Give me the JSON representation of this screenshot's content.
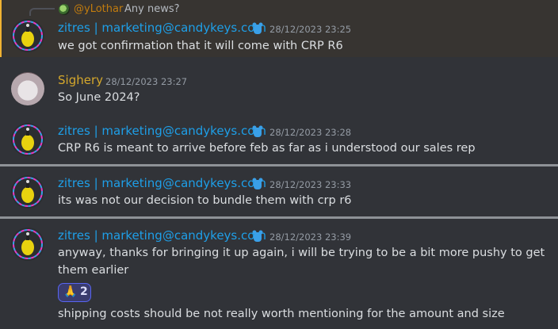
{
  "reply": {
    "name": "@yLothar",
    "text": "Any news?"
  },
  "messages": [
    {
      "author": "zitres | marketing@candykeys.com",
      "timestamp": "28/12/2023 23:25",
      "text": "we got confirmation that it will come with CRP R6",
      "badge_icon": "bear-icon",
      "highlighted": true
    },
    {
      "author": "Sighery",
      "timestamp": "28/12/2023 23:27",
      "text": "So June 2024?"
    },
    {
      "author": "zitres | marketing@candykeys.com",
      "timestamp": "28/12/2023 23:28",
      "text": "CRP R6 is meant to arrive before feb as far as i understood our sales rep",
      "badge_icon": "bear-icon"
    },
    {
      "author": "zitres | marketing@candykeys.com",
      "timestamp": "28/12/2023 23:33",
      "text": "its was not our decision to bundle them with crp r6",
      "badge_icon": "bear-icon"
    },
    {
      "author": "zitres | marketing@candykeys.com",
      "timestamp": "28/12/2023 23:39",
      "text": "anyway, thanks for bringing it up again, i will be trying to be a bit more pushy to get them earlier",
      "badge_icon": "bear-icon",
      "reaction": {
        "emoji": "🙏",
        "count": "2"
      },
      "followup": "shipping costs should be not really worth mentioning for the amount and size"
    }
  ],
  "colors": {
    "background": "#313338",
    "highlight": "#373431",
    "author_zitres": "#1e9fe8",
    "author_sighery": "#d4a72c",
    "reply_name": "#c27c0e"
  }
}
